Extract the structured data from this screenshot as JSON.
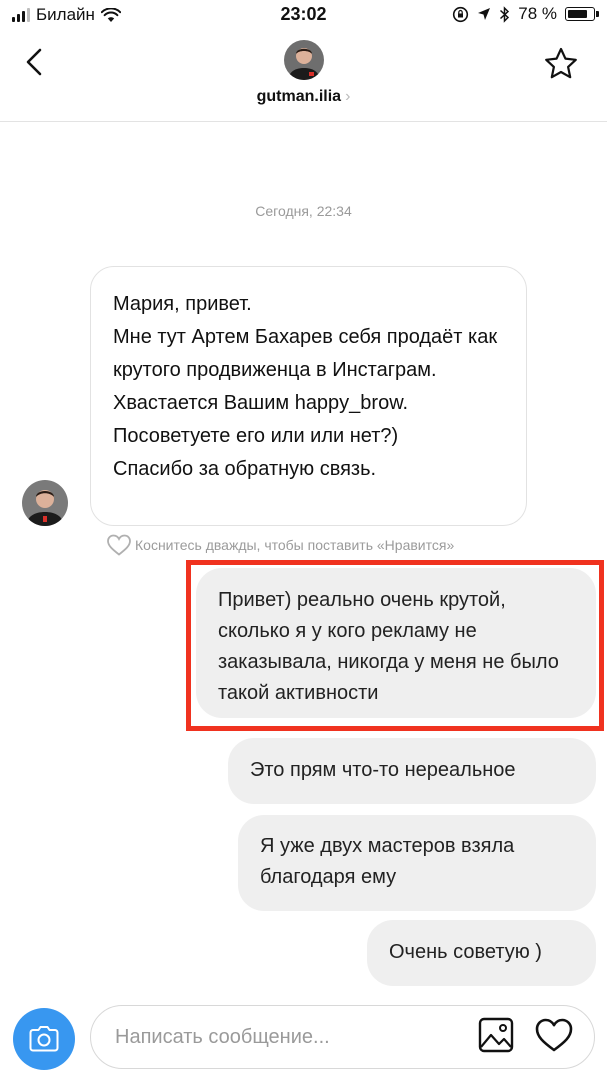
{
  "status_bar": {
    "carrier": "Билайн",
    "time": "23:02",
    "battery_text": "78 %",
    "battery_level": 0.78,
    "icons": [
      "signal-icon",
      "wifi-icon",
      "rotation-lock-icon",
      "location-icon",
      "bluetooth-icon",
      "battery-icon"
    ]
  },
  "header": {
    "username": "gutman.ilia",
    "chevron": "›",
    "icons": [
      "back-arrow-icon",
      "avatar",
      "star-icon"
    ]
  },
  "chat": {
    "timestamp": "Сегодня, 22:34",
    "incoming": {
      "lines": [
        "Мария, привет.",
        "Мне тут Артем Бахарев себя продаёт как крутого продвиженца в Инстаграм. Хвастается Вашим happy_brow.",
        "Посоветуете его или или нет?)",
        "Спасибо за обратную связь."
      ]
    },
    "like_hint": "Коснитесь дважды, чтобы поставить «Нравится»",
    "outgoing": [
      "Привет) реально очень крутой, сколько я у кого рекламу не заказывала, никогда у меня не было такой активности",
      "Это прям что-то нереальное",
      "Я уже двух мастеров взяла благодаря ему",
      "Очень советую )"
    ],
    "highlight_color": "#f0321f"
  },
  "composer": {
    "placeholder": "Написать сообщение...",
    "accent_color": "#3897f0",
    "icons": [
      "camera-icon",
      "gallery-icon",
      "heart-icon"
    ]
  }
}
